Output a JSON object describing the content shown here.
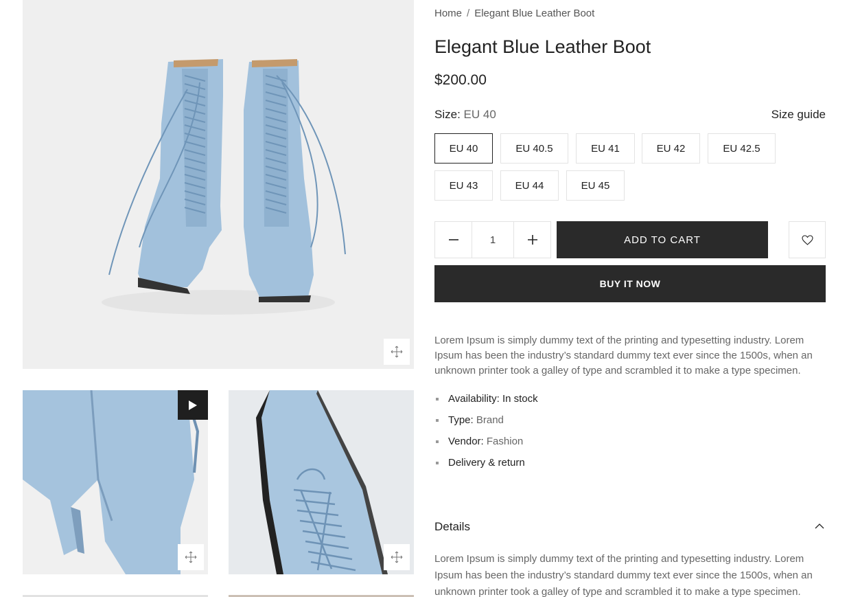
{
  "breadcrumb": {
    "home": "Home",
    "separator": "/",
    "current": "Elegant Blue Leather Boot"
  },
  "product": {
    "title": "Elegant Blue Leather Boot",
    "price": "$200.00"
  },
  "size": {
    "label": "Size:",
    "selected": "EU 40",
    "guide_label": "Size guide",
    "options": [
      "EU 40",
      "EU 40.5",
      "EU 41",
      "EU 42",
      "EU 42.5",
      "EU 43",
      "EU 44",
      "EU 45"
    ]
  },
  "quantity": {
    "value": "1"
  },
  "buttons": {
    "add_to_cart": "ADD TO CART",
    "buy_now": "BUY IT NOW"
  },
  "description": "Lorem Ipsum is simply dummy text of the printing and typesetting industry. Lorem Ipsum has been the industry’s standard dummy text ever since the 1500s, when an unknown printer took a galley of type and scrambled it to make a type specimen.",
  "meta": {
    "availability_label": "Availability:",
    "availability_value": "In stock",
    "type_label": "Type:",
    "type_value": "Brand",
    "vendor_label": "Vendor:",
    "vendor_value": "Fashion",
    "delivery_label": "Delivery & return"
  },
  "details": {
    "heading": "Details",
    "body": "Lorem Ipsum is simply dummy text of the printing and typesetting industry. Lorem Ipsum has been the industry’s standard dummy text ever since the 1500s, when an unknown printer took a galley of type and scrambled it to make a type specimen."
  },
  "icons": {
    "zoom": "arrows-move-icon",
    "video": "play-icon",
    "minus": "minus-icon",
    "plus": "plus-icon",
    "wishlist": "heart-icon",
    "details_toggle": "chevron-up-icon"
  },
  "colors": {
    "button_dark": "#2a2a2a",
    "boot_blue": "#9fbfda",
    "border": "#e3e3e3"
  }
}
